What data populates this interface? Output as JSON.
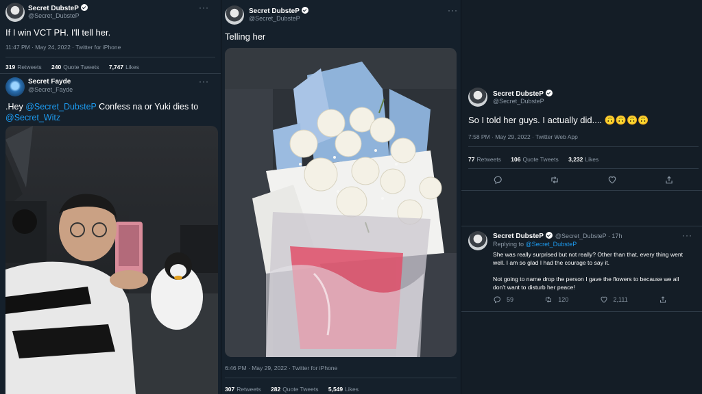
{
  "panel1": {
    "tweet1": {
      "name": "Secret DubsteP",
      "handle": "@Secret_DubsteP",
      "text": "If I win VCT PH. I'll tell her.",
      "meta": "11:47 PM · May 24, 2022 · Twitter for iPhone",
      "retweets": "319",
      "retweets_label": "Retweets",
      "quotes": "240",
      "quotes_label": "Quote Tweets",
      "likes": "7,747",
      "likes_label": "Likes"
    },
    "tweet2": {
      "name": "Secret Fayde",
      "handle": "@Secret_Fayde",
      "text_prefix": ".Hey ",
      "mention1": "@Secret_DubsteP",
      "text_mid": " Confess na or Yuki dies to",
      "mention2": "@Secret_Witz"
    }
  },
  "panel2": {
    "name": "Secret DubsteP",
    "handle": "@Secret_DubsteP",
    "text": "Telling her",
    "meta": "6:46 PM · May 29, 2022 · Twitter for iPhone",
    "retweets": "307",
    "retweets_label": "Retweets",
    "quotes": "282",
    "quotes_label": "Quote Tweets",
    "likes": "5,549",
    "likes_label": "Likes"
  },
  "panel3": {
    "tweet": {
      "name": "Secret DubsteP",
      "handle": "@Secret_DubsteP",
      "text": "So I told her guys. I actually did.... 🙃🙃🙃🙃",
      "meta": "7:58 PM · May 29, 2022 · Twitter Web App",
      "retweets": "77",
      "retweets_label": "Retweets",
      "quotes": "106",
      "quotes_label": "Quote Tweets",
      "likes": "3,232",
      "likes_label": "Likes"
    },
    "reply": {
      "name": "Secret DubsteP",
      "handle_time": "@Secret_DubsteP · 17h",
      "replying_prefix": "Replying to ",
      "replying_to": "@Secret_DubsteP",
      "line1": "She was really surprised but not really? Other than that, every thing went",
      "line2": "well. I am so glad I had the courage to say it.",
      "line3": "Not going to name drop the person I gave the flowers to because we all",
      "line4": "don't want to disturb her peace!",
      "reply_count": "59",
      "retweet_count": "120",
      "like_count": "2,111"
    }
  },
  "colors": {
    "background": "#15202b",
    "link": "#1d9bf0",
    "muted": "#8b98a5",
    "text": "#ffffff"
  },
  "icons": [
    "reply-icon",
    "retweet-icon",
    "like-icon",
    "share-icon",
    "verified-icon",
    "more-icon"
  ]
}
